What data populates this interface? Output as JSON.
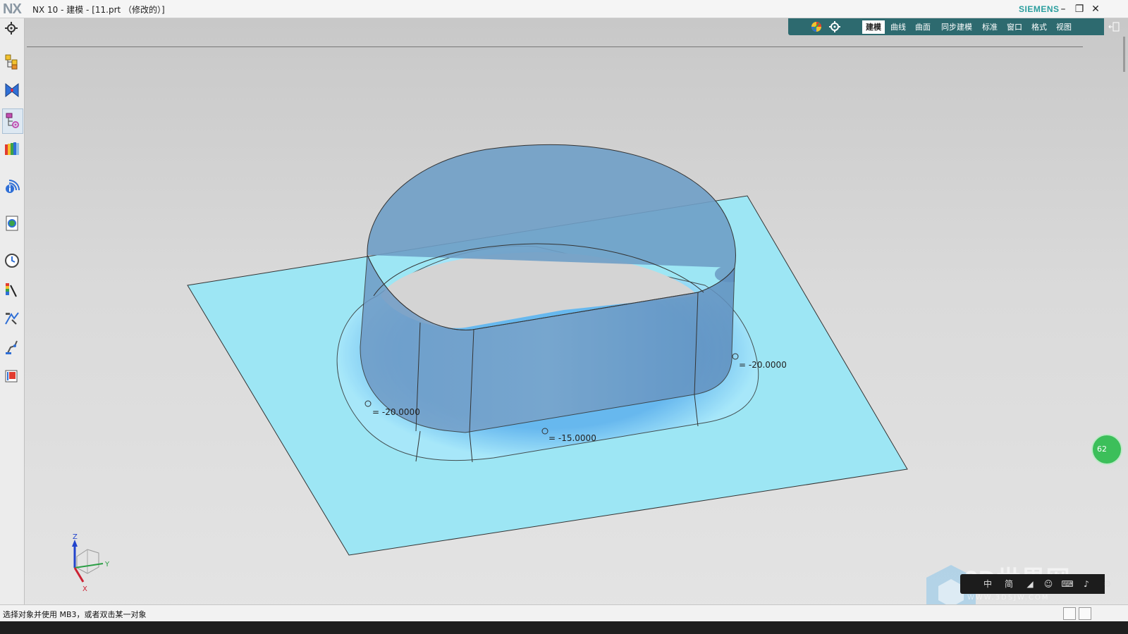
{
  "window": {
    "app_logo": "NX",
    "title": "NX 10 - 建模 - [11.prt （修改的）]",
    "brand": "SIEMENS",
    "controls": {
      "minimize": "–",
      "restore": "❐",
      "close": "✕"
    }
  },
  "ribbon": {
    "tabs": [
      {
        "label": "建模",
        "active": true
      },
      {
        "label": "曲线"
      },
      {
        "label": "曲面"
      },
      {
        "label": "同步建模"
      },
      {
        "label": "标准"
      },
      {
        "label": "窗口"
      },
      {
        "label": "格式"
      },
      {
        "label": "视图"
      }
    ],
    "accent": "#2d6a6f"
  },
  "left_toolbar": {
    "items": [
      "settings-icon",
      "assembly-navigator-icon",
      "constraint-navigator-icon",
      "part-navigator-icon",
      "reuse-library-icon",
      "info-icon",
      "web-browser-icon",
      "history-icon",
      "visual-analysis-icon",
      "process-studio-icon",
      "manufacturing-icon",
      "roles-icon"
    ]
  },
  "viewport": {
    "dimensions": [
      {
        "label": "= -20.0000"
      },
      {
        "label": "= -15.0000"
      },
      {
        "label": "= -20.0000"
      }
    ],
    "triad": {
      "z": "Z",
      "y": "Y",
      "x": "X"
    },
    "colors": {
      "sheet": "#9de6f4",
      "solid": "#6f9ec7",
      "edge": "#333333"
    }
  },
  "badge": {
    "value": "62"
  },
  "status": {
    "text": "选择对象并使用 MB3，或者双击某一对象"
  },
  "watermark": {
    "text": "3D世界网",
    "url_text": "WWW.3DSJW.COM"
  }
}
